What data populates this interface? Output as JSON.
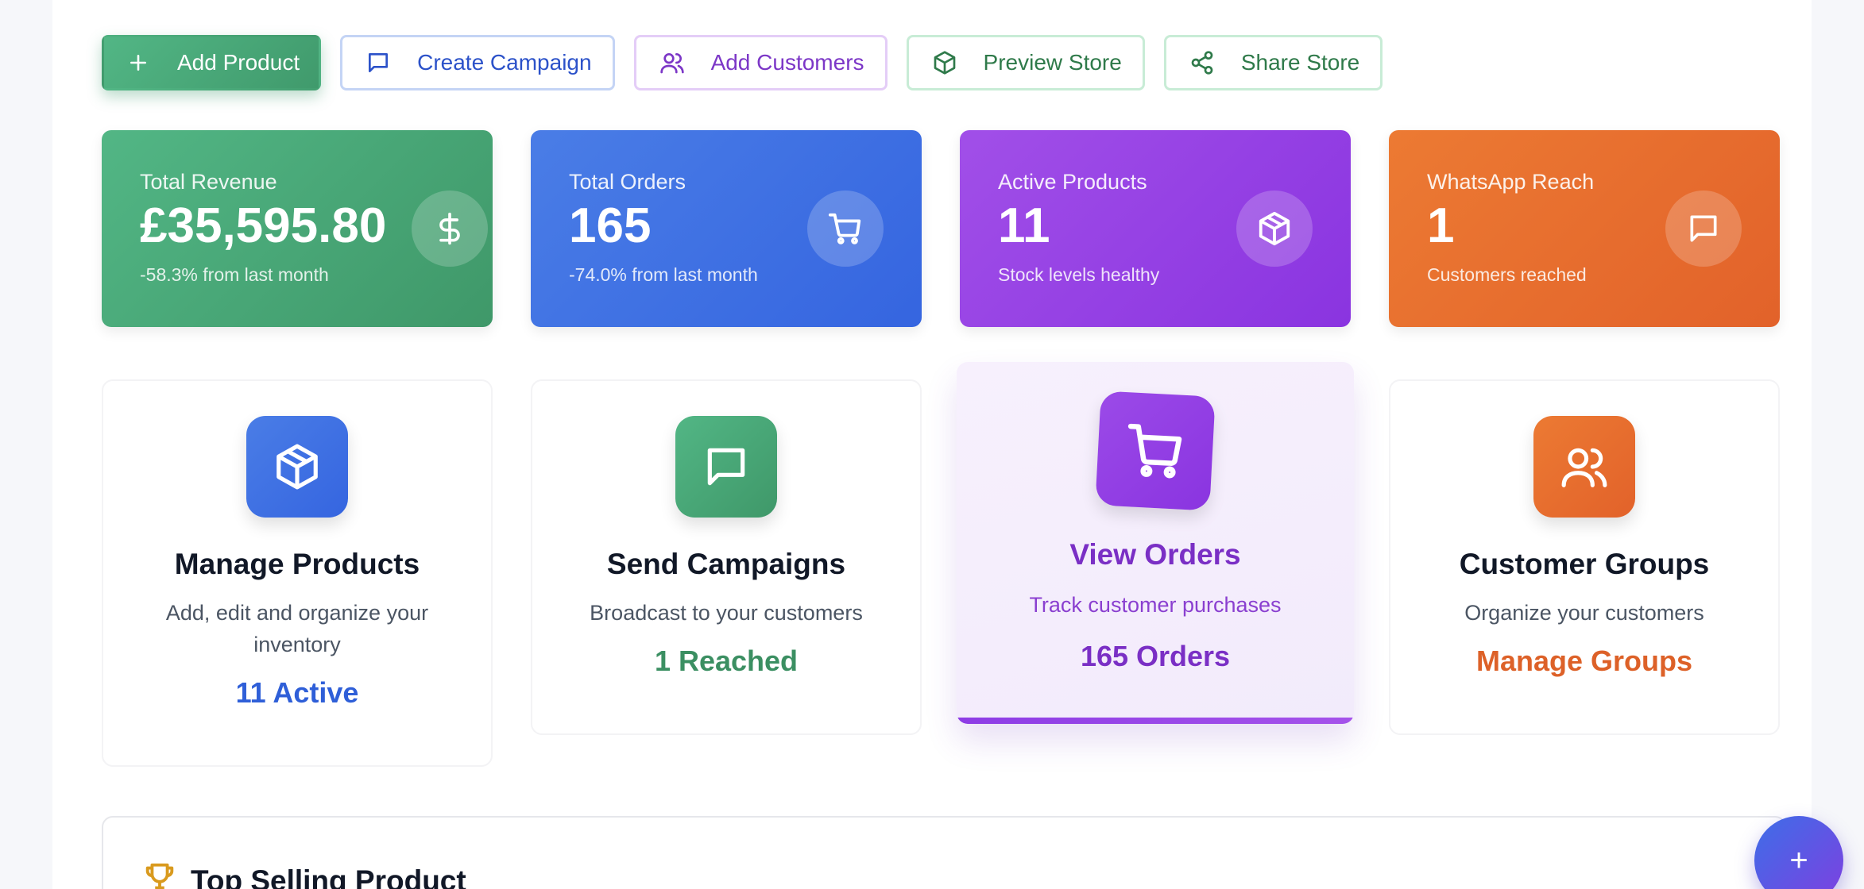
{
  "actions": {
    "add_product": "Add Product",
    "create_campaign": "Create Campaign",
    "add_customers": "Add Customers",
    "preview_store": "Preview Store",
    "share_store": "Share Store"
  },
  "stats": {
    "revenue": {
      "label": "Total Revenue",
      "value": "£35,595.80",
      "sub": "-58.3% from last month",
      "icon": "dollar-icon"
    },
    "orders": {
      "label": "Total Orders",
      "value": "165",
      "sub": "-74.0% from last month",
      "icon": "cart-icon"
    },
    "products": {
      "label": "Active Products",
      "value": "11",
      "sub": "Stock levels healthy",
      "icon": "box-icon"
    },
    "whatsapp": {
      "label": "WhatsApp Reach",
      "value": "1",
      "sub": "Customers reached",
      "icon": "chat-icon"
    }
  },
  "features": {
    "products": {
      "title": "Manage Products",
      "desc": "Add, edit and organize your inventory",
      "meta": "11 Active"
    },
    "campaigns": {
      "title": "Send Campaigns",
      "desc": "Broadcast to your customers",
      "meta": "1 Reached"
    },
    "orders": {
      "title": "View Orders",
      "desc": "Track customer purchases",
      "meta": "165 Orders"
    },
    "groups": {
      "title": "Customer Groups",
      "desc": "Organize your customers",
      "meta": "Manage Groups"
    }
  },
  "top_selling": {
    "title": "Top Selling Product"
  },
  "fab": {
    "label": "+"
  },
  "colors": {
    "green": "#47a877",
    "blue": "#3d6fe4",
    "purple": "#9340e4",
    "orange": "#e66e2e",
    "gold": "#d99a1e"
  }
}
